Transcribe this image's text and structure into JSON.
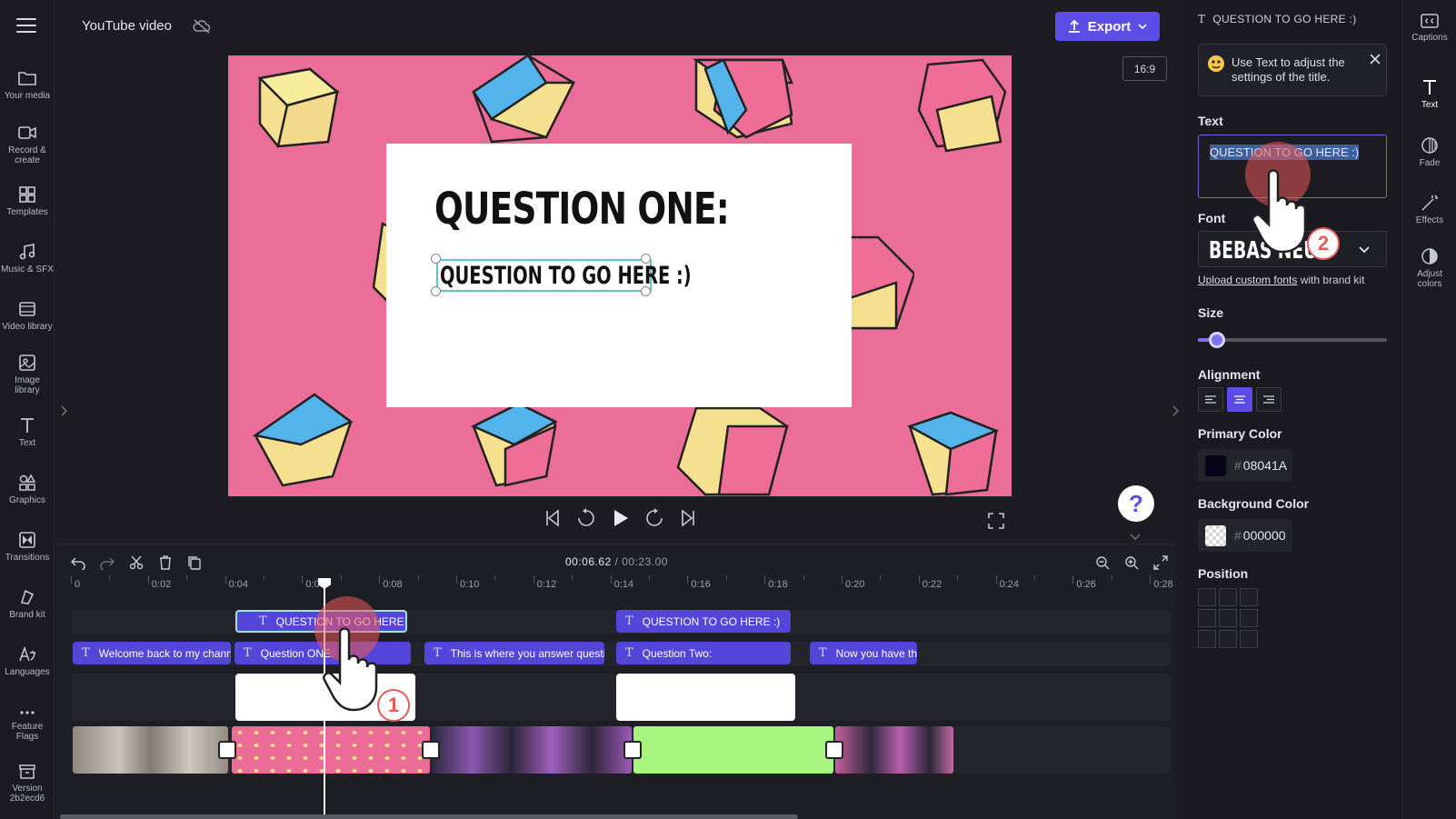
{
  "topbar": {
    "project_title": "YouTube video",
    "export_label": "Export",
    "aspect_ratio": "16:9"
  },
  "leftnav": [
    {
      "label": "Your media",
      "icon": "folder-icon"
    },
    {
      "label": "Record &\ncreate",
      "icon": "camera-icon"
    },
    {
      "label": "Templates",
      "icon": "templates-icon"
    },
    {
      "label": "Music & SFX",
      "icon": "music-icon"
    },
    {
      "label": "Video library",
      "icon": "film-icon"
    },
    {
      "label": "Image\nlibrary",
      "icon": "image-icon"
    },
    {
      "label": "Text",
      "icon": "text-icon"
    },
    {
      "label": "Graphics",
      "icon": "shapes-icon"
    },
    {
      "label": "Transitions",
      "icon": "transitions-icon"
    },
    {
      "label": "Brand kit",
      "icon": "brand-icon"
    },
    {
      "label": "Languages",
      "icon": "languages-icon"
    },
    {
      "label": "Feature\nFlags",
      "icon": "more-icon"
    },
    {
      "label": "Version\n2b2ecd6",
      "icon": "archive-icon"
    }
  ],
  "preview": {
    "title_text": "QUESTION ONE:",
    "subtitle_text": "QUESTION TO GO HERE :)",
    "background_color": "#eb6e98"
  },
  "timeline": {
    "current_time": "00:06.62",
    "total_time": "00:23.00",
    "ruler_labels": [
      "0",
      "0:02",
      "0:04",
      "0:06",
      "0:08",
      "0:10",
      "0:12",
      "0:14",
      "0:16",
      "0:18",
      "0:20",
      "0:22",
      "0:24",
      "0:26",
      "0:28"
    ],
    "text_clips_top": [
      "QUESTION TO GO HERE :)",
      "QUESTION TO GO HERE :)"
    ],
    "text_clips_bottom": [
      "Welcome back to my channel",
      "Question ONE:",
      "This is where you answer question",
      "Question Two:",
      "Now you have the"
    ]
  },
  "panel": {
    "header": "QUESTION TO GO HERE :)",
    "tip_text": "Use Text to adjust the settings of the title.",
    "text_label": "Text",
    "text_value": "QUESTION TO GO HERE :)",
    "font_label": "Font",
    "font_value": "BEBAS NEUE",
    "upload_link": "Upload custom fonts",
    "upload_suffix": " with brand kit",
    "size_label": "Size",
    "size_fraction": 0.1,
    "alignment_label": "Alignment",
    "alignment_selected": "center",
    "primary_color_label": "Primary Color",
    "primary_color_hex": "08041A",
    "background_color_label": "Background Color",
    "background_color_hex": "000000",
    "position_label": "Position",
    "hash": "#"
  },
  "rtabs": [
    {
      "label": "Captions",
      "icon": "captions-icon"
    },
    {
      "label": "Text",
      "icon": "text-icon"
    },
    {
      "label": "Fade",
      "icon": "fade-icon"
    },
    {
      "label": "Effects",
      "icon": "effects-icon"
    },
    {
      "label": "Adjust\ncolors",
      "icon": "adjust-colors-icon"
    }
  ],
  "steps": [
    "1",
    "2"
  ],
  "help_glyph": "?"
}
